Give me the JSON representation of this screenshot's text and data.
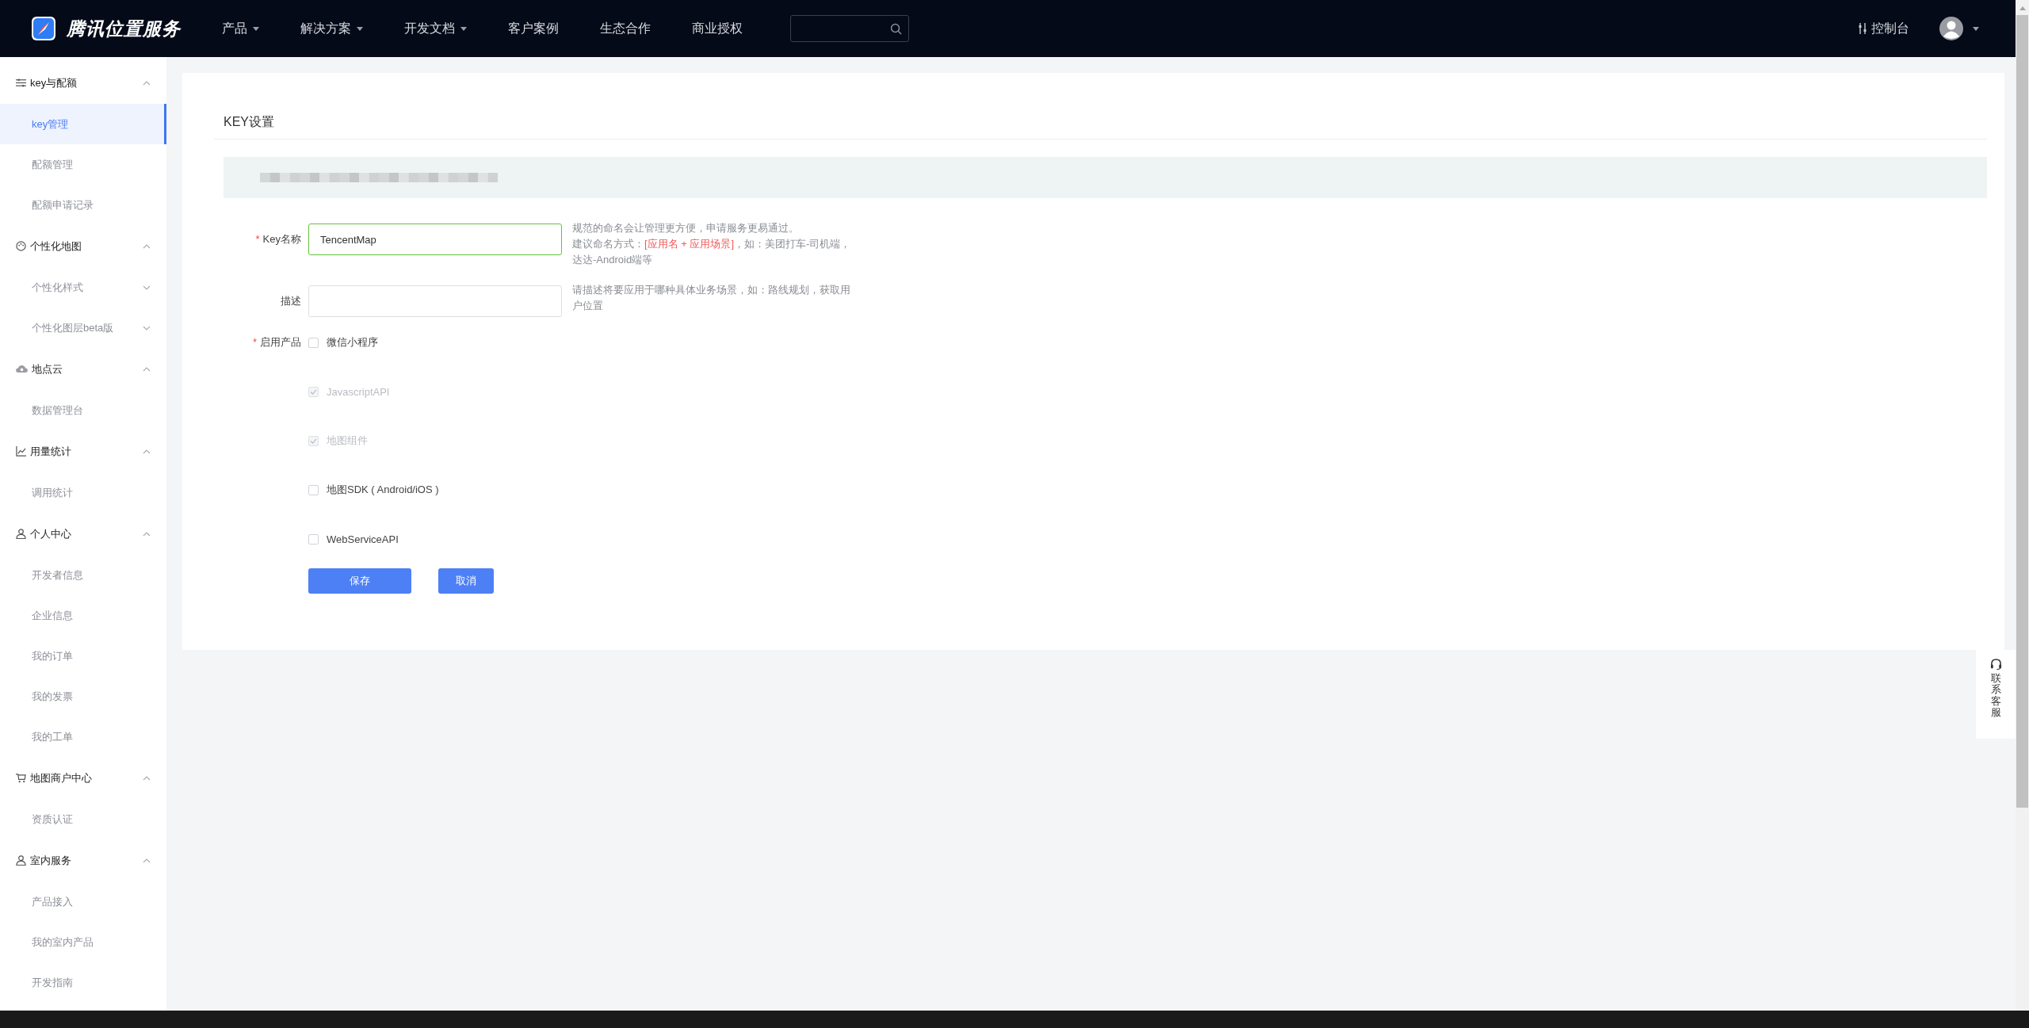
{
  "header": {
    "brand": "腾讯位置服务",
    "nav": [
      {
        "label": "产品",
        "dropdown": true
      },
      {
        "label": "解决方案",
        "dropdown": true
      },
      {
        "label": "开发文档",
        "dropdown": true
      },
      {
        "label": "客户案例",
        "dropdown": false
      },
      {
        "label": "生态合作",
        "dropdown": false
      },
      {
        "label": "商业授权",
        "dropdown": false
      }
    ],
    "console": "控制台"
  },
  "sidebar": {
    "groups": [
      {
        "title": "key与配额",
        "expanded": true,
        "items": [
          {
            "label": "key管理",
            "selected": true
          },
          {
            "label": "配额管理",
            "selected": false
          },
          {
            "label": "配额申请记录",
            "selected": false
          }
        ]
      },
      {
        "title": "个性化地图",
        "expanded": true,
        "items": [
          {
            "label": "个性化样式",
            "selected": false,
            "expanded": false
          },
          {
            "label": "个性化图层beta版",
            "selected": false,
            "expanded": false
          }
        ]
      },
      {
        "title": "地点云",
        "expanded": true,
        "items": [
          {
            "label": "数据管理台",
            "selected": false
          }
        ]
      },
      {
        "title": "用量统计",
        "expanded": true,
        "items": [
          {
            "label": "调用统计",
            "selected": false
          }
        ]
      },
      {
        "title": "个人中心",
        "expanded": true,
        "items": [
          {
            "label": "开发者信息",
            "selected": false
          },
          {
            "label": "企业信息",
            "selected": false
          },
          {
            "label": "我的订单",
            "selected": false
          },
          {
            "label": "我的发票",
            "selected": false
          },
          {
            "label": "我的工单",
            "selected": false
          }
        ]
      },
      {
        "title": "地图商户中心",
        "expanded": true,
        "items": [
          {
            "label": "资质认证",
            "selected": false
          }
        ]
      },
      {
        "title": "室内服务",
        "expanded": true,
        "items": [
          {
            "label": "产品接入",
            "selected": false
          },
          {
            "label": "我的室内产品",
            "selected": false
          },
          {
            "label": "开发指南",
            "selected": false
          }
        ]
      }
    ]
  },
  "form": {
    "title": "KEY设置",
    "fields": [
      {
        "label": "Key名称",
        "required_mark": "*",
        "value": "TencentMap",
        "focused": true,
        "hint": [
          [
            {
              "text": "规范的命名会让管理更方便，申请服务更易通过。",
              "highlight": false
            }
          ],
          [
            {
              "text": "建议命名方式：",
              "highlight": false
            },
            {
              "text": "[应用名 + 应用场景]",
              "highlight": true
            },
            {
              "text": "，如：美团打车-司机端，达达-Android端等",
              "highlight": false
            }
          ]
        ]
      },
      {
        "label": "描述",
        "focused": false,
        "hint": [
          [
            {
              "text": "请描述将要应用于哪种具体业务场景，如：路线规划，获取用户位置",
              "highlight": false
            }
          ]
        ]
      }
    ],
    "products": {
      "label": "启用产品",
      "required_mark": "*",
      "options": [
        {
          "label": "微信小程序",
          "checked": false,
          "disabled": false
        },
        {
          "label": "JavascriptAPI",
          "checked": true,
          "disabled": true
        },
        {
          "label": "地图组件",
          "checked": true,
          "disabled": true
        },
        {
          "label": "地图SDK ( Android/iOS )",
          "checked": false,
          "disabled": false
        },
        {
          "label": "WebServiceAPI",
          "checked": false,
          "disabled": false
        }
      ]
    },
    "buttons": [
      {
        "label": "保存",
        "kind": "submit"
      },
      {
        "label": "取消",
        "kind": "cancel"
      }
    ]
  },
  "service_widget": {
    "label": "联系客服"
  }
}
